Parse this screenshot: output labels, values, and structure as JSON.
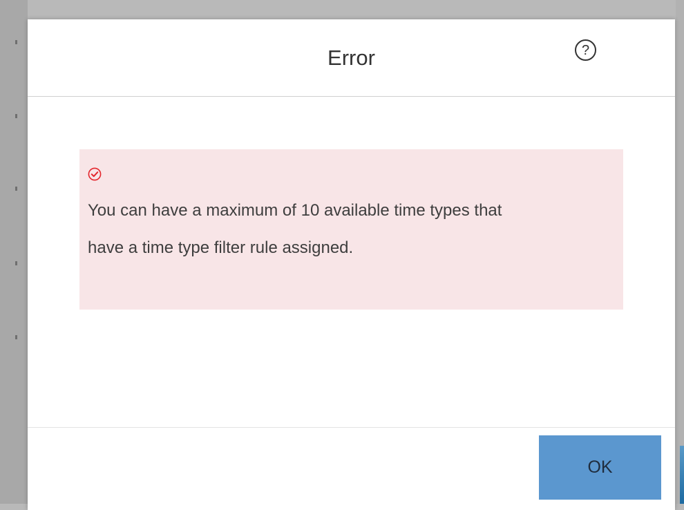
{
  "dialog": {
    "title": "Error",
    "help_icon": "question-circle-icon",
    "help_glyph": "?"
  },
  "alert": {
    "icon": "check-circle-icon",
    "icon_color": "#e4252c",
    "background": "#f8e5e7",
    "message": "You can have a maximum of 10 available time types that have a time type filter rule assigned."
  },
  "footer": {
    "ok_label": "OK",
    "ok_color": "#5b97cf"
  }
}
